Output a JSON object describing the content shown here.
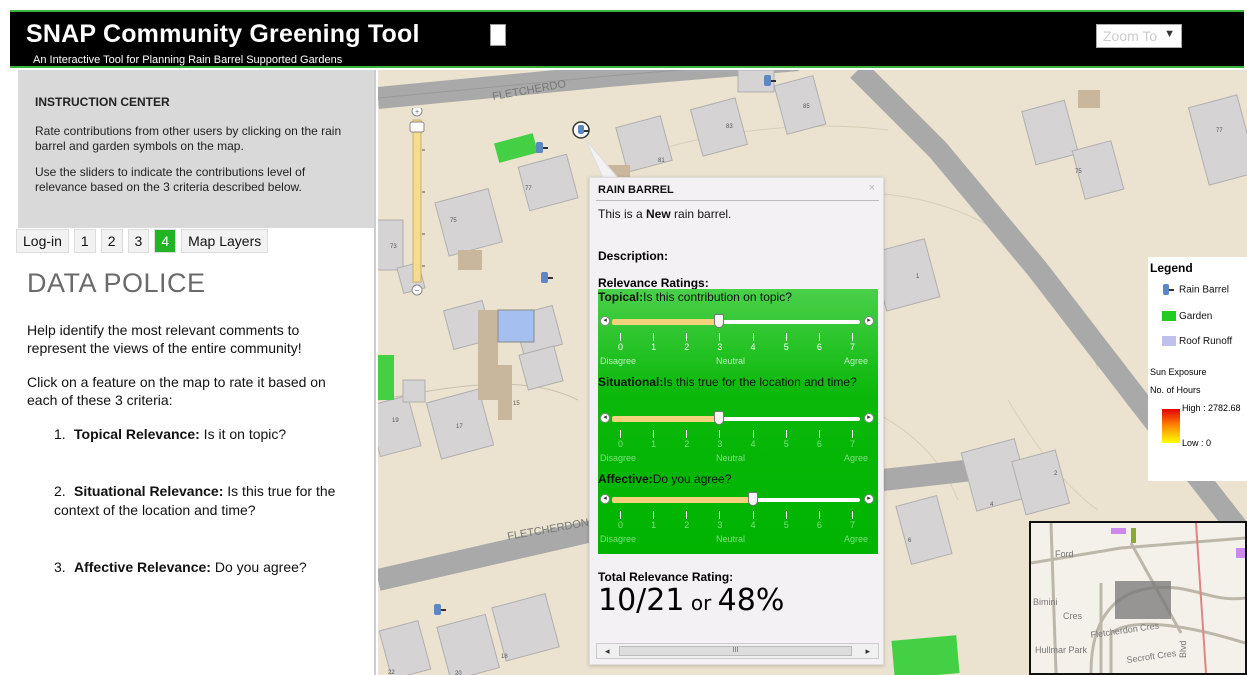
{
  "header": {
    "title": "SNAP Community Greening Tool",
    "subtitle": "An Interactive Tool for Planning Rain Barrel Supported Gardens",
    "zoom_placeholder": "Zoom To",
    "zoom_icon": "chevron-down-icon"
  },
  "instruction": {
    "title": "INSTRUCTION CENTER",
    "para1": "Rate contributions from other users by clicking on the rain barrel and garden symbols on the map.",
    "para2": "Use the sliders to indicate the contributions level of relevance based on the 3 criteria described below."
  },
  "tabs": [
    {
      "label": "Log-in"
    },
    {
      "label": "1"
    },
    {
      "label": "2"
    },
    {
      "label": "3"
    },
    {
      "label": "4",
      "active": true
    },
    {
      "label": "Map Layers"
    }
  ],
  "content": {
    "title": "DATA POLICE",
    "p1": "Help identify the most relevant comments to represent the views of the entire community!",
    "p2": "Click on a feature on the map to rate it based on each of these 3 criteria:",
    "criteria": [
      {
        "num": "1.",
        "bold": "Topical Relevance:",
        "text": " Is it on topic?"
      },
      {
        "num": "2.",
        "bold": "Situational Relevance:",
        "text": " Is this true for the context of the location and time?"
      },
      {
        "num": "3.",
        "bold": "Affective Relevance:",
        "text": " Do you agree?"
      }
    ]
  },
  "map": {
    "street_names": [
      "FLETCHERDO",
      "FLETCHERDON"
    ],
    "house_numbers": [
      "85",
      "83",
      "81",
      "77",
      "75",
      "73",
      "15",
      "17",
      "19",
      "20",
      "22",
      "18",
      "77",
      "75",
      "1",
      "2",
      "4",
      "6"
    ],
    "zoom_plus": "+",
    "zoom_minus": "−",
    "colors": {
      "land": "#ebe3d0",
      "building": "#d4d2d2",
      "road": "#9c9c9c",
      "garden": "#44d044"
    }
  },
  "popup": {
    "title": "RAIN BARREL",
    "close": "×",
    "intro_pre": "This is a ",
    "intro_bold": "New",
    "intro_post": " rain barrel.",
    "description_label": "Description:",
    "relevance_label": "Relevance Ratings:",
    "scale_min": "Disagree",
    "scale_mid": "Neutral",
    "scale_max": "Agree",
    "scale_ticks": [
      "0",
      "1",
      "2",
      "3",
      "4",
      "5",
      "6",
      "7"
    ],
    "sliders": [
      {
        "label_bold": "Topical:",
        "label": "Is this contribution on topic?",
        "value": 3,
        "max": 7
      },
      {
        "label_bold": "Situational:",
        "label": "Is this true for the location and time?",
        "value": 3,
        "max": 7
      },
      {
        "label_bold": "Affective:",
        "label": "Do you agree?",
        "value": 4,
        "max": 7
      }
    ],
    "total_label": "Total Relevance Rating:",
    "total_score": "10/21",
    "total_or": " or ",
    "total_percent": "48%",
    "scroll_grip": "III",
    "scroll_left": "◂",
    "scroll_right": "▸"
  },
  "legend": {
    "title": "Legend",
    "items": [
      {
        "label": "Rain Barrel",
        "icon": "rain-barrel-icon"
      },
      {
        "label": "Garden",
        "color": "#22cc22"
      },
      {
        "label": "Roof Runoff",
        "color": "#c0c0ee"
      }
    ],
    "sun_label": "Sun Exposure",
    "hours_label": "No. of Hours",
    "high_label": "High : 2782.68",
    "low_label": "Low : 0"
  },
  "overview": {
    "labels": [
      "Ford",
      "Bimini",
      "Cres",
      "Fletcherdon Cres",
      "Hullmar Park",
      "Secroft Cres",
      "Blvd"
    ]
  }
}
